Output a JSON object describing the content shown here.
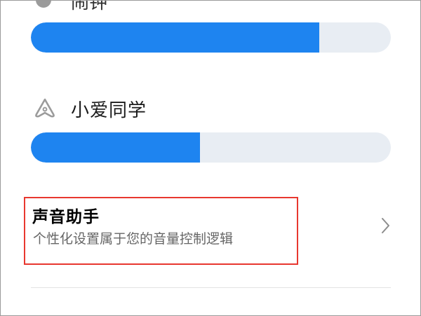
{
  "top_item": {
    "label": "闹钟",
    "icon": "circle-icon",
    "level": 0.801
  },
  "xiaoai": {
    "label": "小爱同学",
    "icon": "xiaoai-logo-icon",
    "level": 0.469
  },
  "assistant": {
    "title": "声音助手",
    "description": "个性化设置属于您的音量控制逻辑",
    "icon": "chevron-right-icon"
  },
  "colors": {
    "accent": "#1e84f0",
    "track": "#e8edf3",
    "highlight": "#e8372f"
  }
}
